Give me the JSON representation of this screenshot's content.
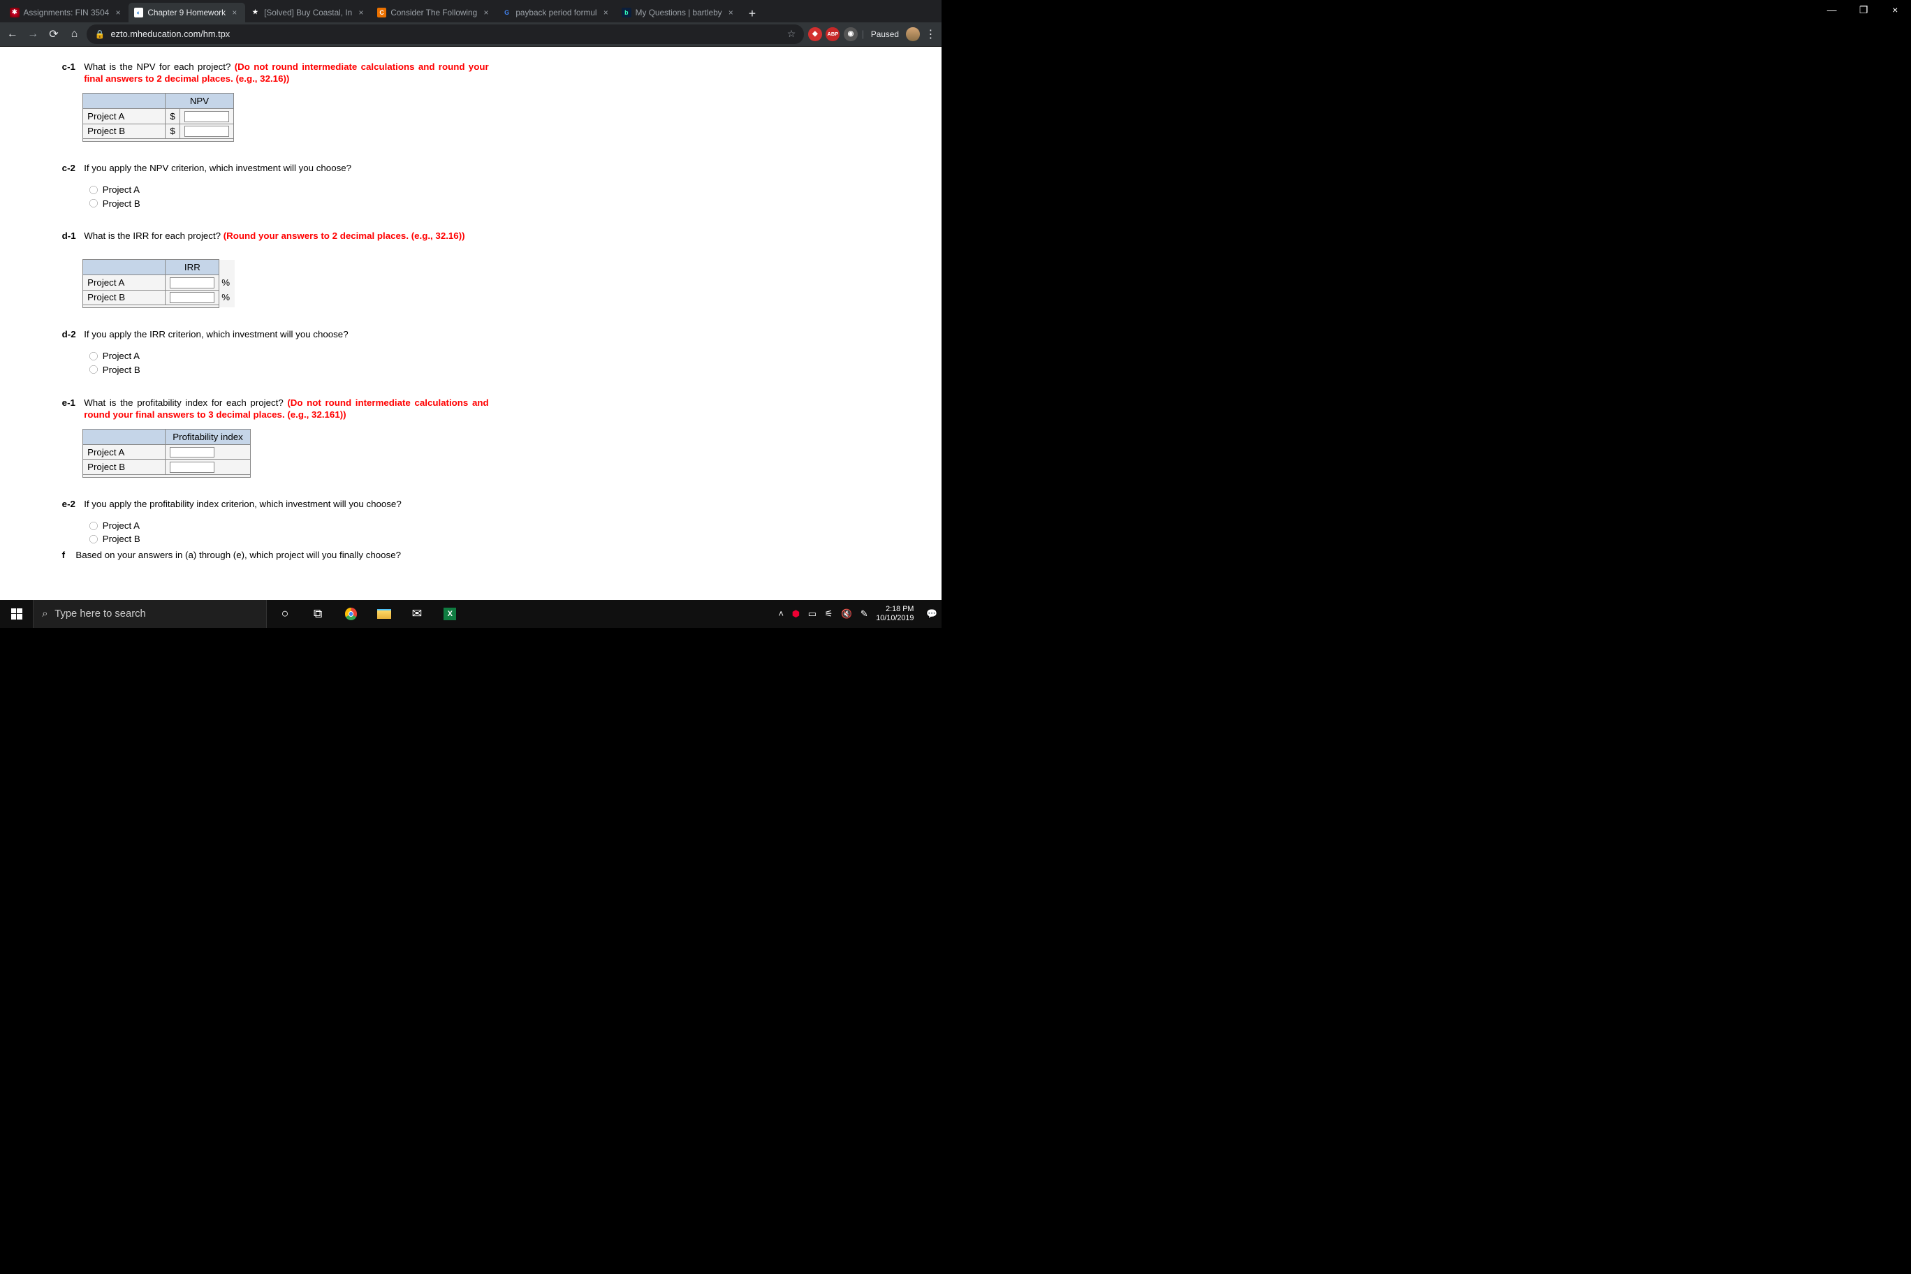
{
  "tabs": [
    {
      "title": "Assignments: FIN 3504"
    },
    {
      "title": "Chapter 9 Homework"
    },
    {
      "title": "[Solved] Buy Coastal, In"
    },
    {
      "title": "Consider The Following"
    },
    {
      "title": "payback period formul"
    },
    {
      "title": "My Questions | bartleby"
    }
  ],
  "url": "ezto.mheducation.com/hm.tpx",
  "paused_label": "Paused",
  "questions": {
    "c1": {
      "label": "c-1",
      "text": "What is the NPV for each project? ",
      "red": "(Do not round intermediate calculations and round your final answers to 2 decimal places. (e.g., 32.16))"
    },
    "c2": {
      "label": "c-2",
      "text": "If you apply the NPV criterion, which investment will you choose?"
    },
    "d1": {
      "label": "d-1",
      "text": "What is the IRR for each project? ",
      "red": "(Round your answers to 2 decimal places. (e.g., 32.16))"
    },
    "d2": {
      "label": "d-2",
      "text": "If you apply the IRR criterion, which investment will you choose?"
    },
    "e1": {
      "label": "e-1",
      "text": "What is the profitability index for each project? ",
      "red": "(Do not round intermediate calculations and round your final answers to 3 decimal places. (e.g., 32.161))"
    },
    "e2": {
      "label": "e-2",
      "text": "If you apply the profitability index criterion, which investment will you choose?"
    },
    "f": {
      "label": "f",
      "text": "Based on your answers in (a) through (e), which project will you finally choose?"
    }
  },
  "tables": {
    "npv_header": "NPV",
    "irr_header": "IRR",
    "pi_header": "Profitability index",
    "rowA": "Project A",
    "rowB": "Project B",
    "dollar": "$",
    "percent": "%"
  },
  "options": {
    "a": "Project A",
    "b": "Project B"
  },
  "taskbar": {
    "search_placeholder": "Type here to search",
    "time": "2:18 PM",
    "date": "10/10/2019"
  }
}
